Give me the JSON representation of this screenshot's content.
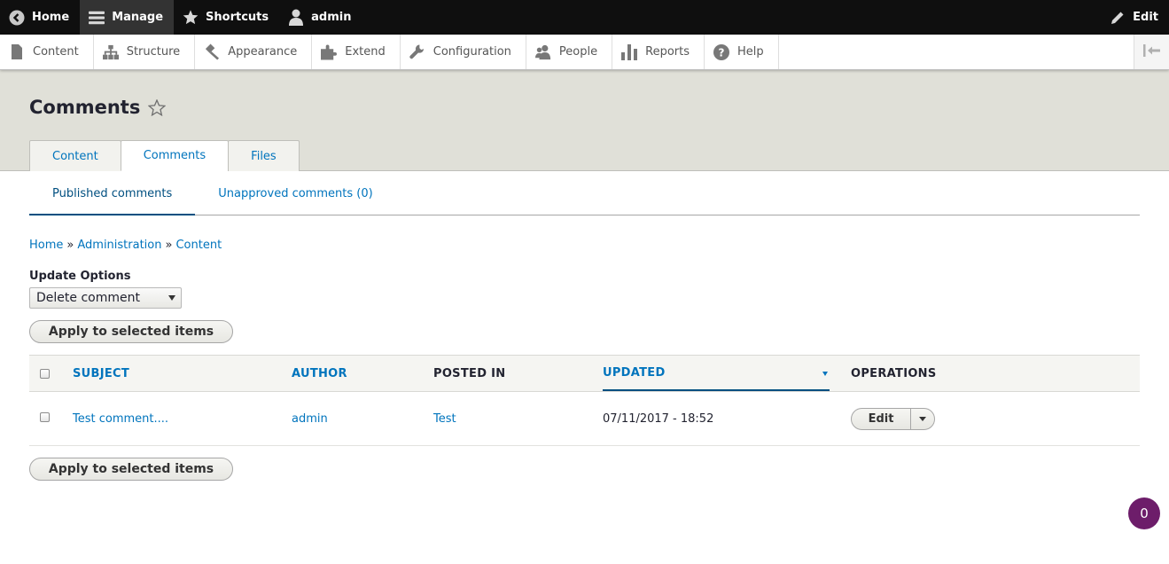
{
  "toolbar": {
    "home": "Home",
    "manage": "Manage",
    "shortcuts": "Shortcuts",
    "user": "admin",
    "edit": "Edit"
  },
  "tray": {
    "items": [
      "Content",
      "Structure",
      "Appearance",
      "Extend",
      "Configuration",
      "People",
      "Reports",
      "Help"
    ]
  },
  "page": {
    "title": "Comments",
    "tabs": [
      "Content",
      "Comments",
      "Files"
    ],
    "active_tab": "Comments",
    "subtabs": [
      "Published comments",
      "Unapproved comments (0)"
    ]
  },
  "breadcrumb": [
    "Home",
    "Administration",
    "Content"
  ],
  "breadcrumb_sep": "»",
  "bulk": {
    "label": "Update Options",
    "selected": "Delete comment",
    "apply": "Apply to selected items"
  },
  "table": {
    "headers": {
      "subject": "SUBJECT",
      "author": "AUTHOR",
      "posted_in": "POSTED IN",
      "updated": "UPDATED",
      "operations": "OPERATIONS"
    },
    "rows": [
      {
        "subject": "Test comment....",
        "author": "admin",
        "posted_in": "Test",
        "updated": "07/11/2017 - 18:52",
        "operation": "Edit"
      }
    ]
  },
  "badge": "0",
  "colors": {
    "link": "#0074bd",
    "toolbar_bg": "#0f0f0f",
    "header_bg": "#e0e0d8",
    "badge": "#6d1d6a"
  }
}
